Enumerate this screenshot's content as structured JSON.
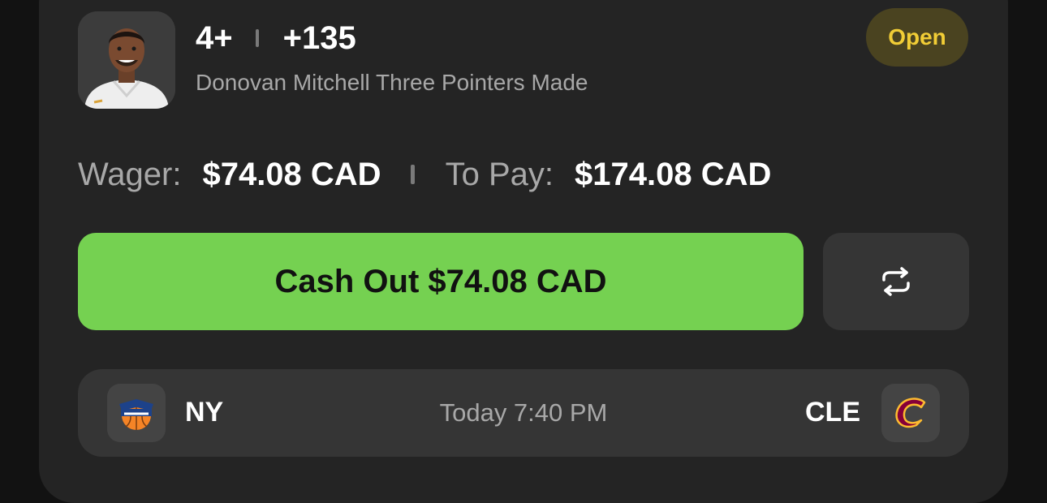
{
  "bet": {
    "line": "4+",
    "odds": "+135",
    "market": "Donovan Mitchell Three Pointers Made",
    "status": "Open",
    "player_avatar": "player-headshot"
  },
  "amounts": {
    "wager_label": "Wager:",
    "wager_value": "$74.08 CAD",
    "topay_label": "To Pay:",
    "topay_value": "$174.08 CAD"
  },
  "actions": {
    "cashout_label": "Cash Out $74.08 CAD",
    "repeat_icon": "repeat-icon"
  },
  "game": {
    "home_abbr": "NY",
    "home_logo": "knicks-logo-icon",
    "time": "Today 7:40 PM",
    "away_abbr": "CLE",
    "away_logo": "cavaliers-logo-icon"
  },
  "colors": {
    "card_bg": "#242424",
    "cashout_green": "#75d151",
    "status_yellow": "#f1cd36",
    "status_bg": "#4a4320",
    "muted_text": "#a8a8a8"
  }
}
